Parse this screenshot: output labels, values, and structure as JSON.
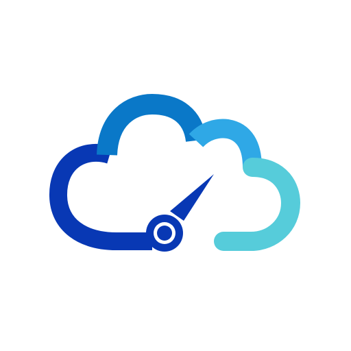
{
  "icon": {
    "name": "cloud-speedometer-icon",
    "colors": {
      "dark_blue": "#0838B4",
      "mid_blue": "#0A78C8",
      "sky_blue": "#2FA8E6",
      "teal": "#56CCDA",
      "background": "#FFFFFF"
    }
  }
}
